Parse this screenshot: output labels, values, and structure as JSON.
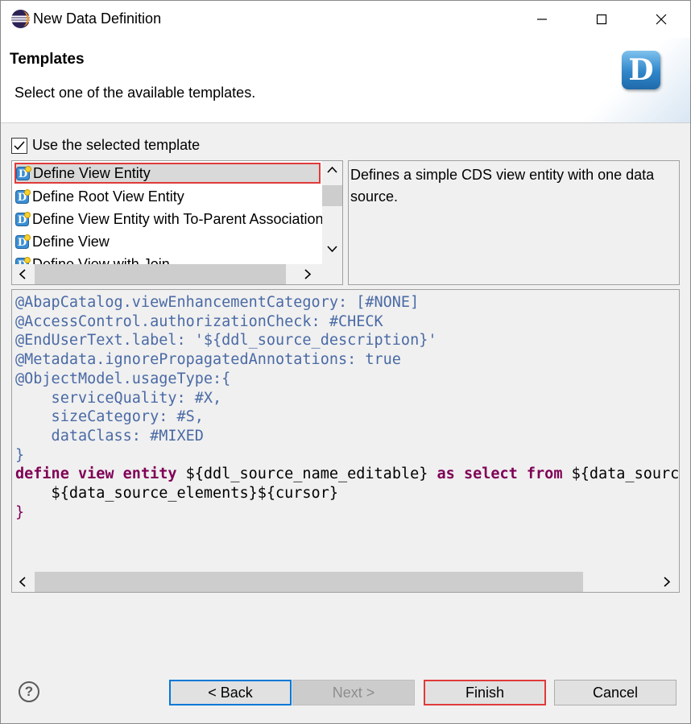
{
  "window": {
    "title": "New Data Definition"
  },
  "banner": {
    "title": "Templates",
    "subtitle": "Select one of the available templates.",
    "logo_letter": "D"
  },
  "use_template": {
    "label": "Use the selected template",
    "checked": true
  },
  "templates": [
    {
      "label": "Define View Entity",
      "selected": true
    },
    {
      "label": "Define Root View Entity",
      "selected": false
    },
    {
      "label": "Define View Entity with To-Parent Association",
      "selected": false
    },
    {
      "label": "Define View",
      "selected": false
    },
    {
      "label": "Define View with Join",
      "selected": false
    }
  ],
  "description": "Defines a simple CDS view entity with one data source.",
  "code": {
    "lines": [
      "@AbapCatalog.viewEnhancementCategory: [#NONE]",
      "@AccessControl.authorizationCheck: #CHECK",
      "@EndUserText.label: '${ddl_source_description}'",
      "@Metadata.ignorePropagatedAnnotations: true",
      "@ObjectModel.usageType:{",
      "    serviceQuality: #X,",
      "    sizeCategory: #S,",
      "    dataClass: #MIXED",
      "}",
      "define view entity ${ddl_source_name_editable} as select from ${data_source_name}",
      "    ${data_source_elements}${cursor}",
      "}"
    ]
  },
  "buttons": {
    "back": "< Back",
    "next": "Next >",
    "finish": "Finish",
    "cancel": "Cancel",
    "help": "?"
  },
  "colors": {
    "annotation": "#4a6aa5",
    "keyword": "#7f0055",
    "highlight_border": "#e03a3a",
    "default_button_border": "#0078d7"
  }
}
